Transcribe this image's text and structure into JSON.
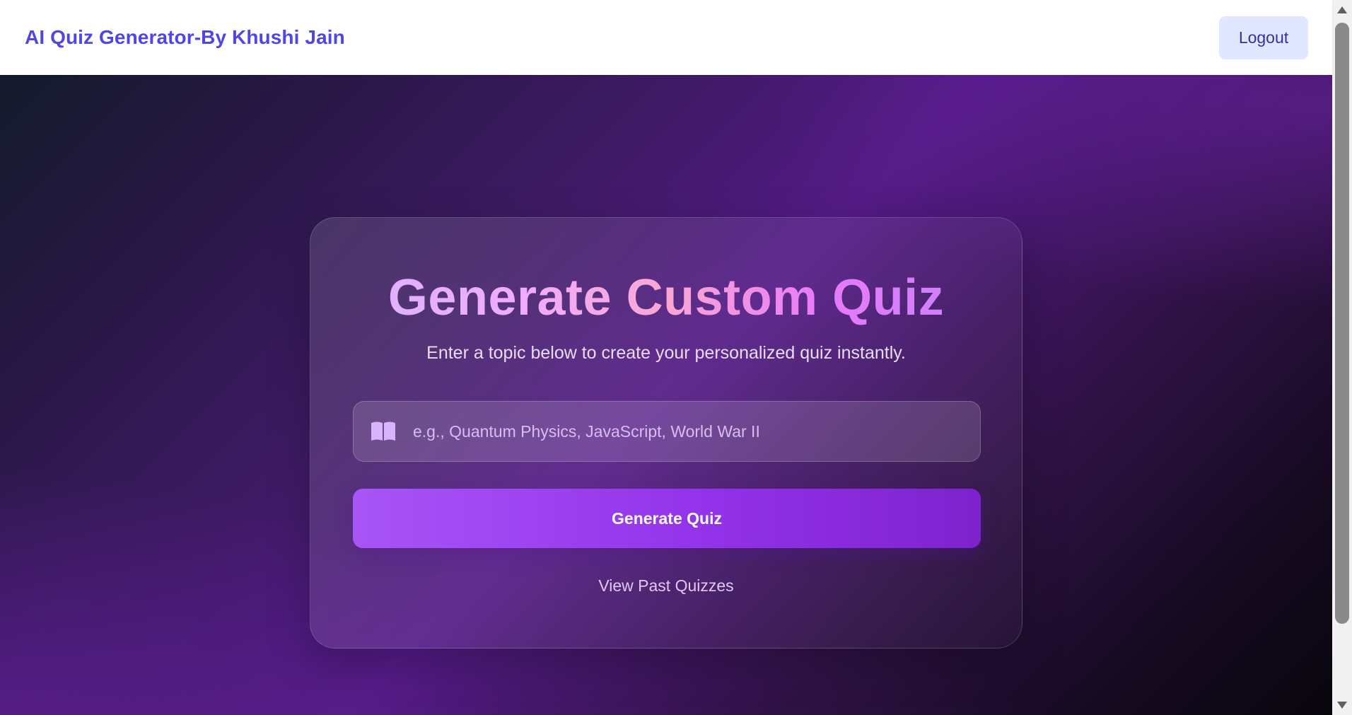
{
  "header": {
    "brand": "AI Quiz Generator-By Khushi Jain",
    "logout_label": "Logout"
  },
  "card": {
    "title": "Generate Custom Quiz",
    "subtitle": "Enter a topic below to create your personalized quiz instantly.",
    "topic_input": {
      "placeholder": "e.g., Quantum Physics, JavaScript, World War II",
      "value": "",
      "icon": "book-open-icon"
    },
    "generate_label": "Generate Quiz",
    "past_quizzes_label": "View Past Quizzes"
  },
  "colors": {
    "brand": "#4f46e5",
    "logout_bg": "#e0e7ff",
    "button_start": "#a855f7",
    "button_end": "#7e22ce",
    "hero_dark": "#131a2b",
    "hero_purple": "#541b86"
  }
}
